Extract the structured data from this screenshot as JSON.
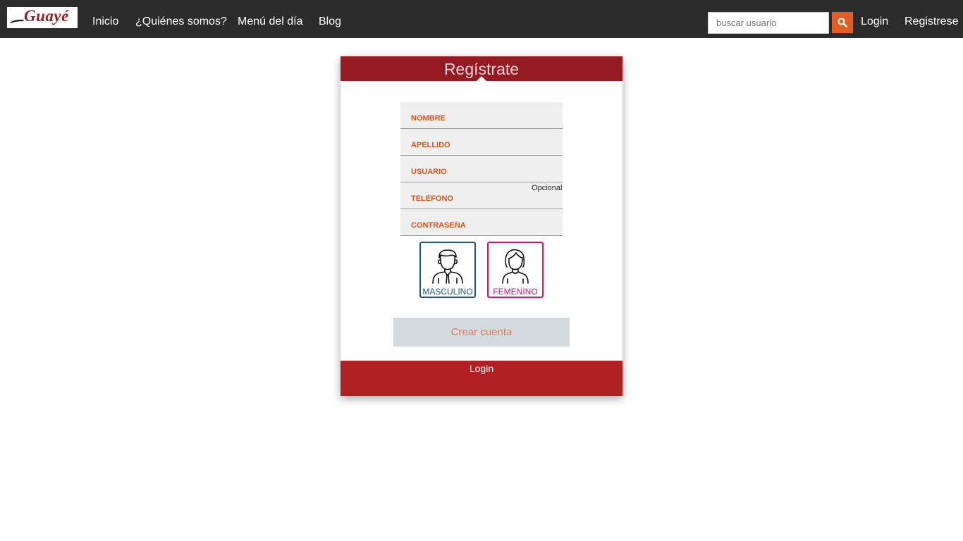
{
  "navbar": {
    "logo_text": "Guayé",
    "links": {
      "inicio": "Inicio",
      "quienes": "¿Quiénes somos?",
      "menu": "Menú del día",
      "blog": "Blog"
    },
    "search": {
      "placeholder": "buscar usuario",
      "icon": "search-icon",
      "button_color": "#e55d23"
    },
    "login": "Login",
    "registrese": "Registrese"
  },
  "card": {
    "title": "Regístrate",
    "header_color": "#961a21",
    "fields": {
      "nombre": {
        "placeholder": "NOMBRE",
        "value": ""
      },
      "apellido": {
        "placeholder": "APELLIDO",
        "value": ""
      },
      "usuario": {
        "placeholder": "USUARIO",
        "value": ""
      },
      "telefono": {
        "placeholder": "TELÉFONO",
        "value": ""
      },
      "contrasena": {
        "placeholder": "CONTRASEÑA",
        "value": ""
      }
    },
    "optional_note": "Opcional",
    "gender": {
      "male": {
        "label": "MASCULINO",
        "icon": "male-avatar-icon",
        "color": "#1d5a83"
      },
      "female": {
        "label": "FEMENINO",
        "icon": "female-avatar-icon",
        "color": "#d1137a"
      }
    },
    "create_button": "Crear cuenta",
    "footer_login": "Login",
    "footer_color": "#b12124"
  }
}
